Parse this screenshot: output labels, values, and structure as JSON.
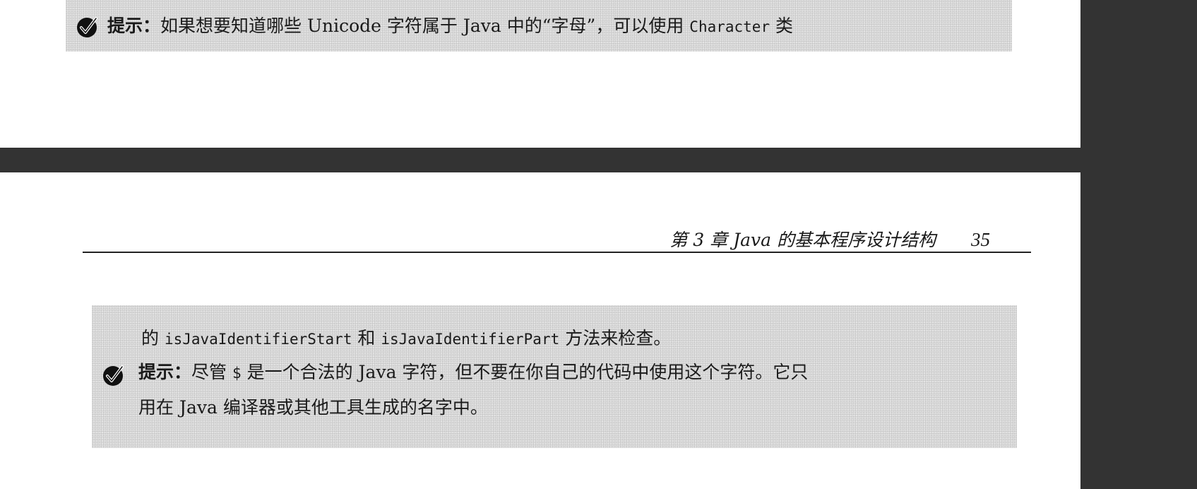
{
  "page_top": {
    "tip": {
      "icon": "check-badge-icon",
      "label": "提示：",
      "text_before": "如果想要知道哪些 Unicode 字符属于 Java 中的“字母”，可以使用 ",
      "code": "Character",
      "text_after": " 类"
    }
  },
  "page_bottom": {
    "header": {
      "chapter": "第 3 章  Java 的基本程序设计结构",
      "page_number": "35"
    },
    "continuation": {
      "text_before": "的 ",
      "code1": "isJavaIdentifierStart",
      "middle": " 和 ",
      "code2": "isJavaIdentifierPart",
      "text_after": " 方法来检查。"
    },
    "tip": {
      "icon": "check-badge-icon",
      "label": "提示：",
      "line1_before": "尽管 ",
      "dollar": "$",
      "line1_after": " 是一个合法的 Java 字符，但不要在你自己的代码中使用这个字符。它只",
      "line2": "用在 Java 编译器或其他工具生成的名字中。"
    }
  },
  "colors": {
    "background": "#333333",
    "page": "#ffffff",
    "shade": "#dcdcdc",
    "text": "#1a1a1a"
  }
}
